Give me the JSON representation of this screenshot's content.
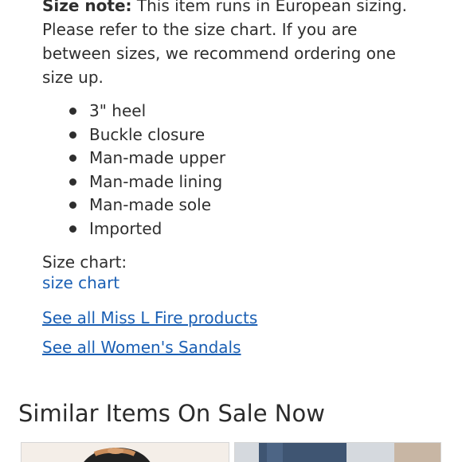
{
  "description": {
    "size_note_label": "Size note:",
    "size_note_text": " This item runs in European sizing. Please refer to the size chart. If you are between sizes, we recommend ordering one size up."
  },
  "features": [
    "3\" heel",
    "Buckle closure",
    "Man-made upper",
    "Man-made lining",
    "Man-made sole",
    "Imported"
  ],
  "size_chart": {
    "label": "Size chart:",
    "link_text": "size chart"
  },
  "links": {
    "brand": "See all Miss L Fire products",
    "category": "See all Women's Sandals"
  },
  "similar": {
    "title": "Similar Items On Sale Now"
  },
  "colors": {
    "link": "#1a5fb4",
    "text": "#2e2e2e"
  }
}
